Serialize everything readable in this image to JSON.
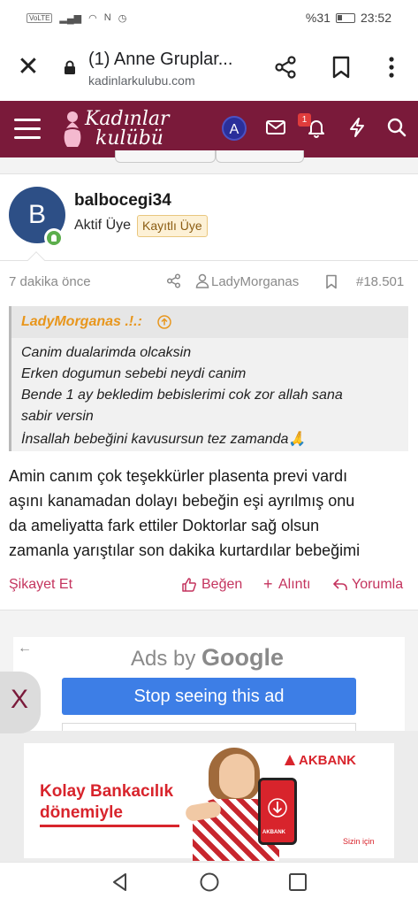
{
  "status_bar": {
    "volte": "VoLTE",
    "battery": "%31",
    "time": "23:52"
  },
  "browser": {
    "tab_title": "(1) Anne Gruplar...",
    "url": "kadinlarkulubu.com"
  },
  "site": {
    "logo_line1": "Kadınlar",
    "logo_line2": "kulübü",
    "user_initial": "A",
    "notification_count": "1",
    "brand_color": "#7a1a3a"
  },
  "post": {
    "avatar_initial": "B",
    "username": "balbocegi34",
    "user_title": "Aktif Üye",
    "user_banner": "Kayıtlı Üye",
    "time_ago": "7 dakika önce",
    "reply_to": "LadyMorganas",
    "post_number": "#18.501",
    "quote": {
      "author": "LadyMorganas .!.:",
      "lines": [
        "Canim dualarimda olcaksin",
        "Erken dogumun sebebi neydi canim",
        "Bende 1 ay bekledim bebislerimi cok zor allah sana",
        "sabir versin",
        "İnsallah bebeğini kavusursun tez zamanda🙏"
      ]
    },
    "body_lines": [
      "Amin canım çok teşekkürler plasenta previ vardı",
      "aşını kanamadan dolayı bebeğin eşi ayrılmış onu",
      "da ameliyatta fark ettiler Doktorlar sağ olsun",
      "zamanla yarıştılar son dakika kurtardılar bebeğimi"
    ],
    "actions": {
      "report": "Şikayet Et",
      "like": "Beğen",
      "quote": "Alıntı",
      "reply": "Yorumla"
    }
  },
  "ad": {
    "back_arrow": "←",
    "ads_by": "Ads by",
    "google": "Google",
    "stop_label": "Stop seeing this ad",
    "close_label": "X",
    "banner_line1": "Kolay Bankacılık",
    "banner_line2": "dönemiyle",
    "banner_brand": "AKBANK",
    "banner_tag": "Sizin için",
    "phone_brand": "AKBANK"
  }
}
